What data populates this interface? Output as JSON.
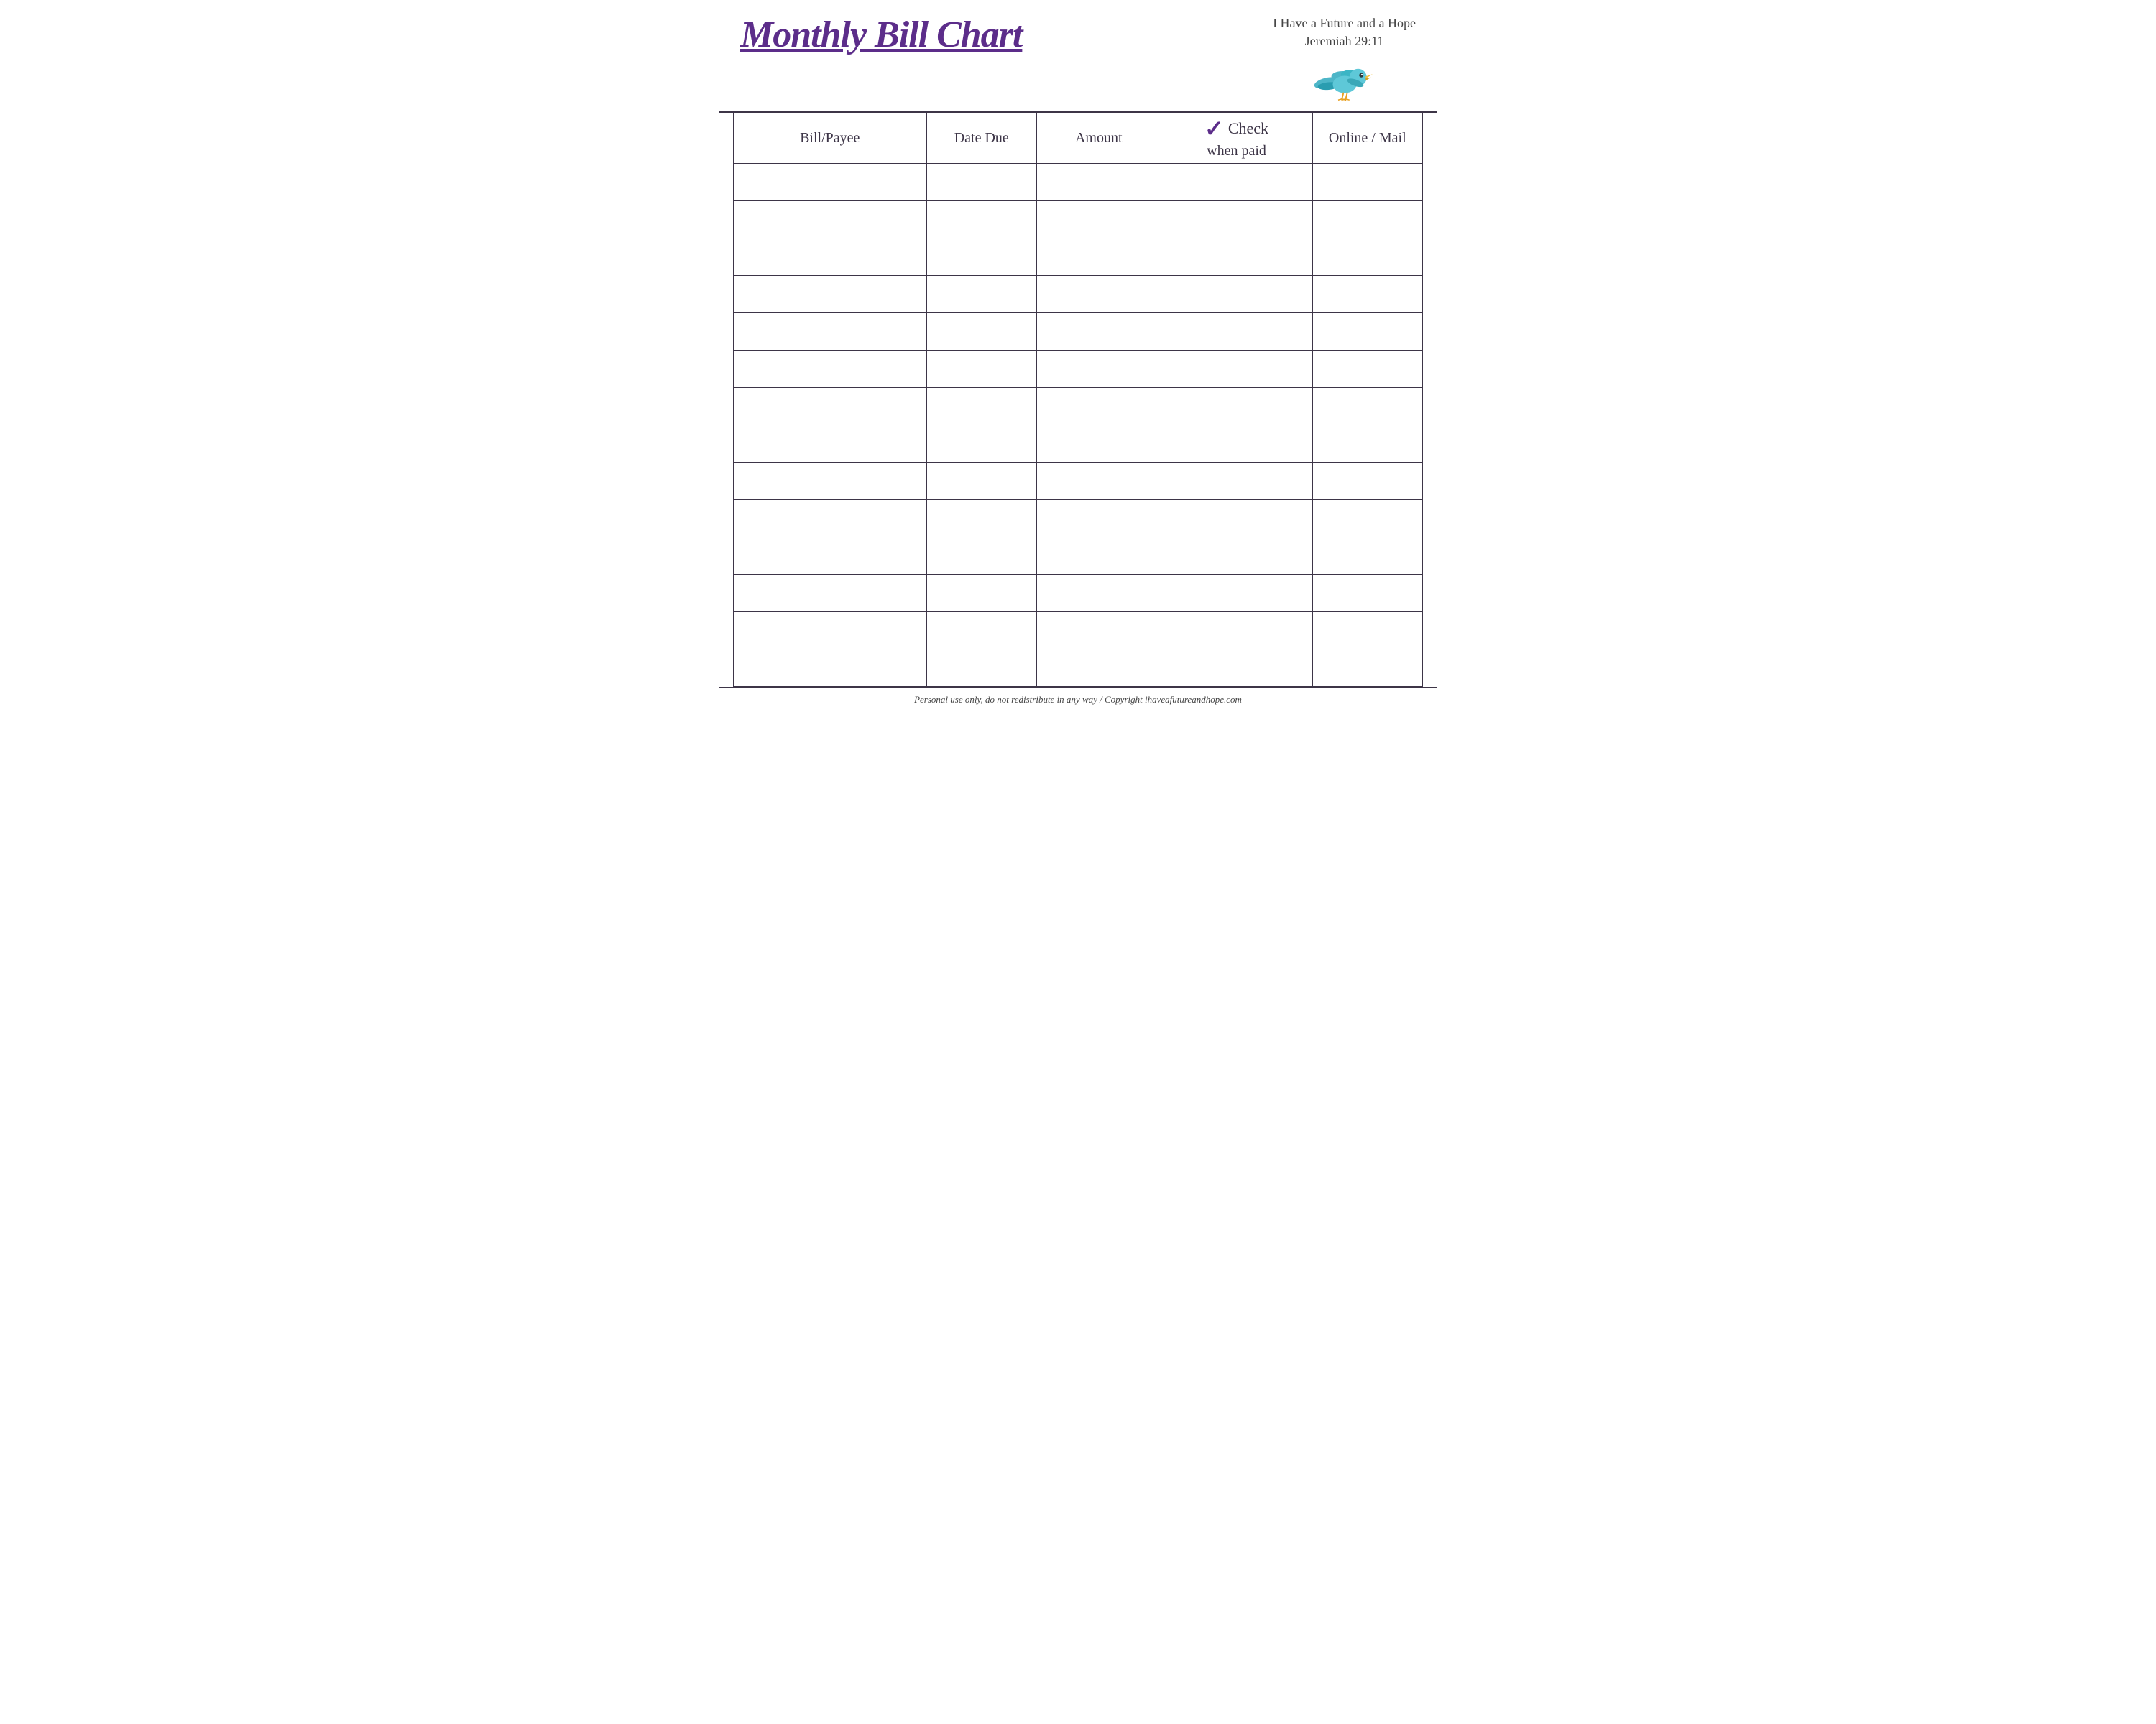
{
  "header": {
    "title": "Monthly Bill Chart",
    "scripture_line1": "I Have a Future and a Hope",
    "scripture_line2": "Jeremiah 29:11"
  },
  "table": {
    "columns": [
      {
        "key": "payee",
        "label": "Bill/Payee"
      },
      {
        "key": "date",
        "label": "Date Due"
      },
      {
        "key": "amount",
        "label": "Amount"
      },
      {
        "key": "check",
        "label_top": "Check",
        "label_bottom": "when paid",
        "has_checkmark": true
      },
      {
        "key": "online",
        "label": "Online / Mail"
      }
    ],
    "row_count": 14
  },
  "footer": {
    "text": "Personal use only, do not redistribute in any way / Copyright ihaveafutureandhope.com"
  }
}
